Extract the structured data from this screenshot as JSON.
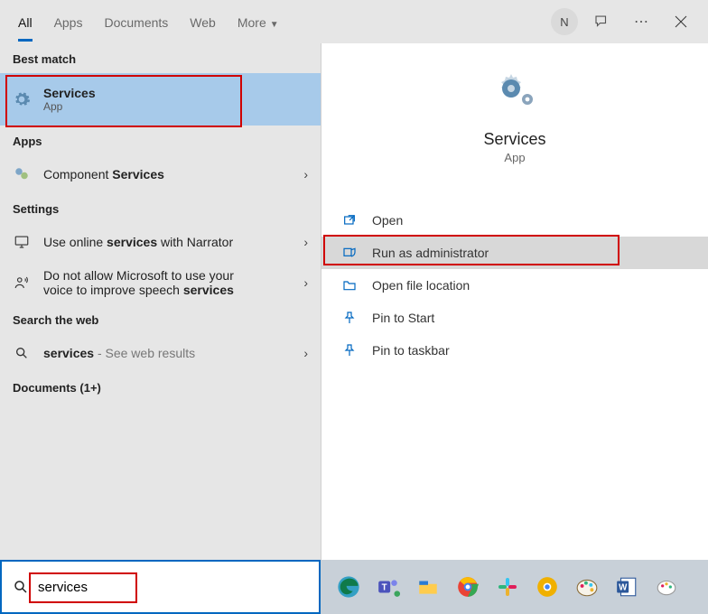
{
  "tabs": {
    "all": "All",
    "apps": "Apps",
    "documents": "Documents",
    "web": "Web",
    "more": "More"
  },
  "avatar_initial": "N",
  "sections": {
    "best_match": "Best match",
    "apps": "Apps",
    "settings": "Settings",
    "search_web": "Search the web",
    "documents": "Documents (1+)"
  },
  "best": {
    "title": "Services",
    "subtitle": "App"
  },
  "results": {
    "component_services_prefix": "Component ",
    "component_services_bold": "Services",
    "narrator_prefix": "Use online ",
    "narrator_bold": "services",
    "narrator_suffix": " with Narrator",
    "donot_line1": "Do not allow Microsoft to use your",
    "donot_line2_prefix": "voice to improve speech ",
    "donot_line2_bold": "services",
    "web_prefix_bold": "services",
    "web_suffix": " - See web results"
  },
  "preview": {
    "title": "Services",
    "subtitle": "App",
    "actions": {
      "open": "Open",
      "run_admin": "Run as administrator",
      "open_loc": "Open file location",
      "pin_start": "Pin to Start",
      "pin_taskbar": "Pin to taskbar"
    }
  },
  "search_input": "services"
}
